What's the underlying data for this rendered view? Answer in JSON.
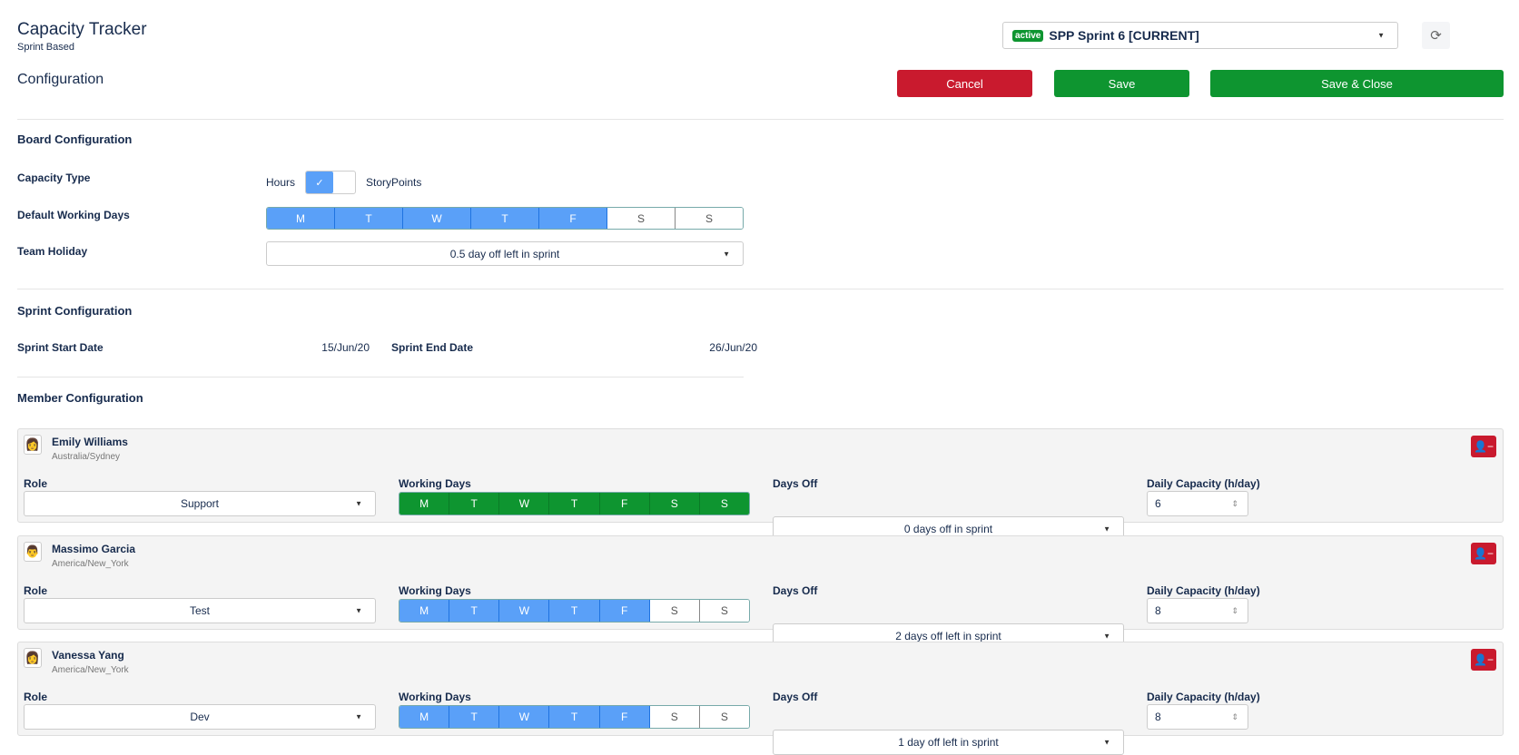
{
  "header": {
    "title": "Capacity Tracker",
    "subtitle": "Sprint Based",
    "section": "Configuration",
    "sprint": {
      "badge": "active",
      "name": "SPP Sprint 6 [CURRENT]"
    },
    "cancel": "Cancel",
    "save": "Save",
    "save_close": "Save & Close"
  },
  "board": {
    "title": "Board Configuration",
    "capacity_type_label": "Capacity Type",
    "hours": "Hours",
    "story_points": "StoryPoints",
    "toggle_checked": "✓",
    "toggle_value": "Hours",
    "working_days_label": "Default Working Days",
    "days": [
      {
        "d": "M",
        "on": true
      },
      {
        "d": "T",
        "on": true
      },
      {
        "d": "W",
        "on": true
      },
      {
        "d": "T",
        "on": true
      },
      {
        "d": "F",
        "on": true
      },
      {
        "d": "S",
        "on": false
      },
      {
        "d": "S",
        "on": false
      }
    ],
    "team_holiday_label": "Team Holiday",
    "team_holiday": "0.5 day off left in sprint"
  },
  "sprint_conf": {
    "title": "Sprint Configuration",
    "start_label": "Sprint Start Date",
    "start": "15/Jun/20",
    "end_label": "Sprint End Date",
    "end": "26/Jun/20"
  },
  "members_title": "Member Configuration",
  "labels": {
    "role": "Role",
    "working_days": "Working Days",
    "days_off": "Days Off",
    "daily": "Daily Capacity (h/day)"
  },
  "members": [
    {
      "name": "Emily Williams",
      "tz": "Australia/Sydney",
      "role": "Support",
      "days_off": "0 days off in sprint",
      "capacity": "6",
      "style": "green",
      "days": [
        1,
        1,
        1,
        1,
        1,
        1,
        1
      ],
      "avatar": "👩"
    },
    {
      "name": "Massimo Garcia",
      "tz": "America/New_York",
      "role": "Test",
      "days_off": "2 days off left in sprint",
      "capacity": "8",
      "style": "blue",
      "days": [
        1,
        1,
        1,
        1,
        1,
        0,
        0
      ],
      "avatar": "👨"
    },
    {
      "name": "Vanessa Yang",
      "tz": "America/New_York",
      "role": "Dev",
      "days_off": "1 day off left in sprint",
      "capacity": "8",
      "style": "blue",
      "days": [
        1,
        1,
        1,
        1,
        1,
        0,
        0
      ],
      "avatar": "👩"
    }
  ],
  "day_letters": [
    "M",
    "T",
    "W",
    "T",
    "F",
    "S",
    "S"
  ]
}
